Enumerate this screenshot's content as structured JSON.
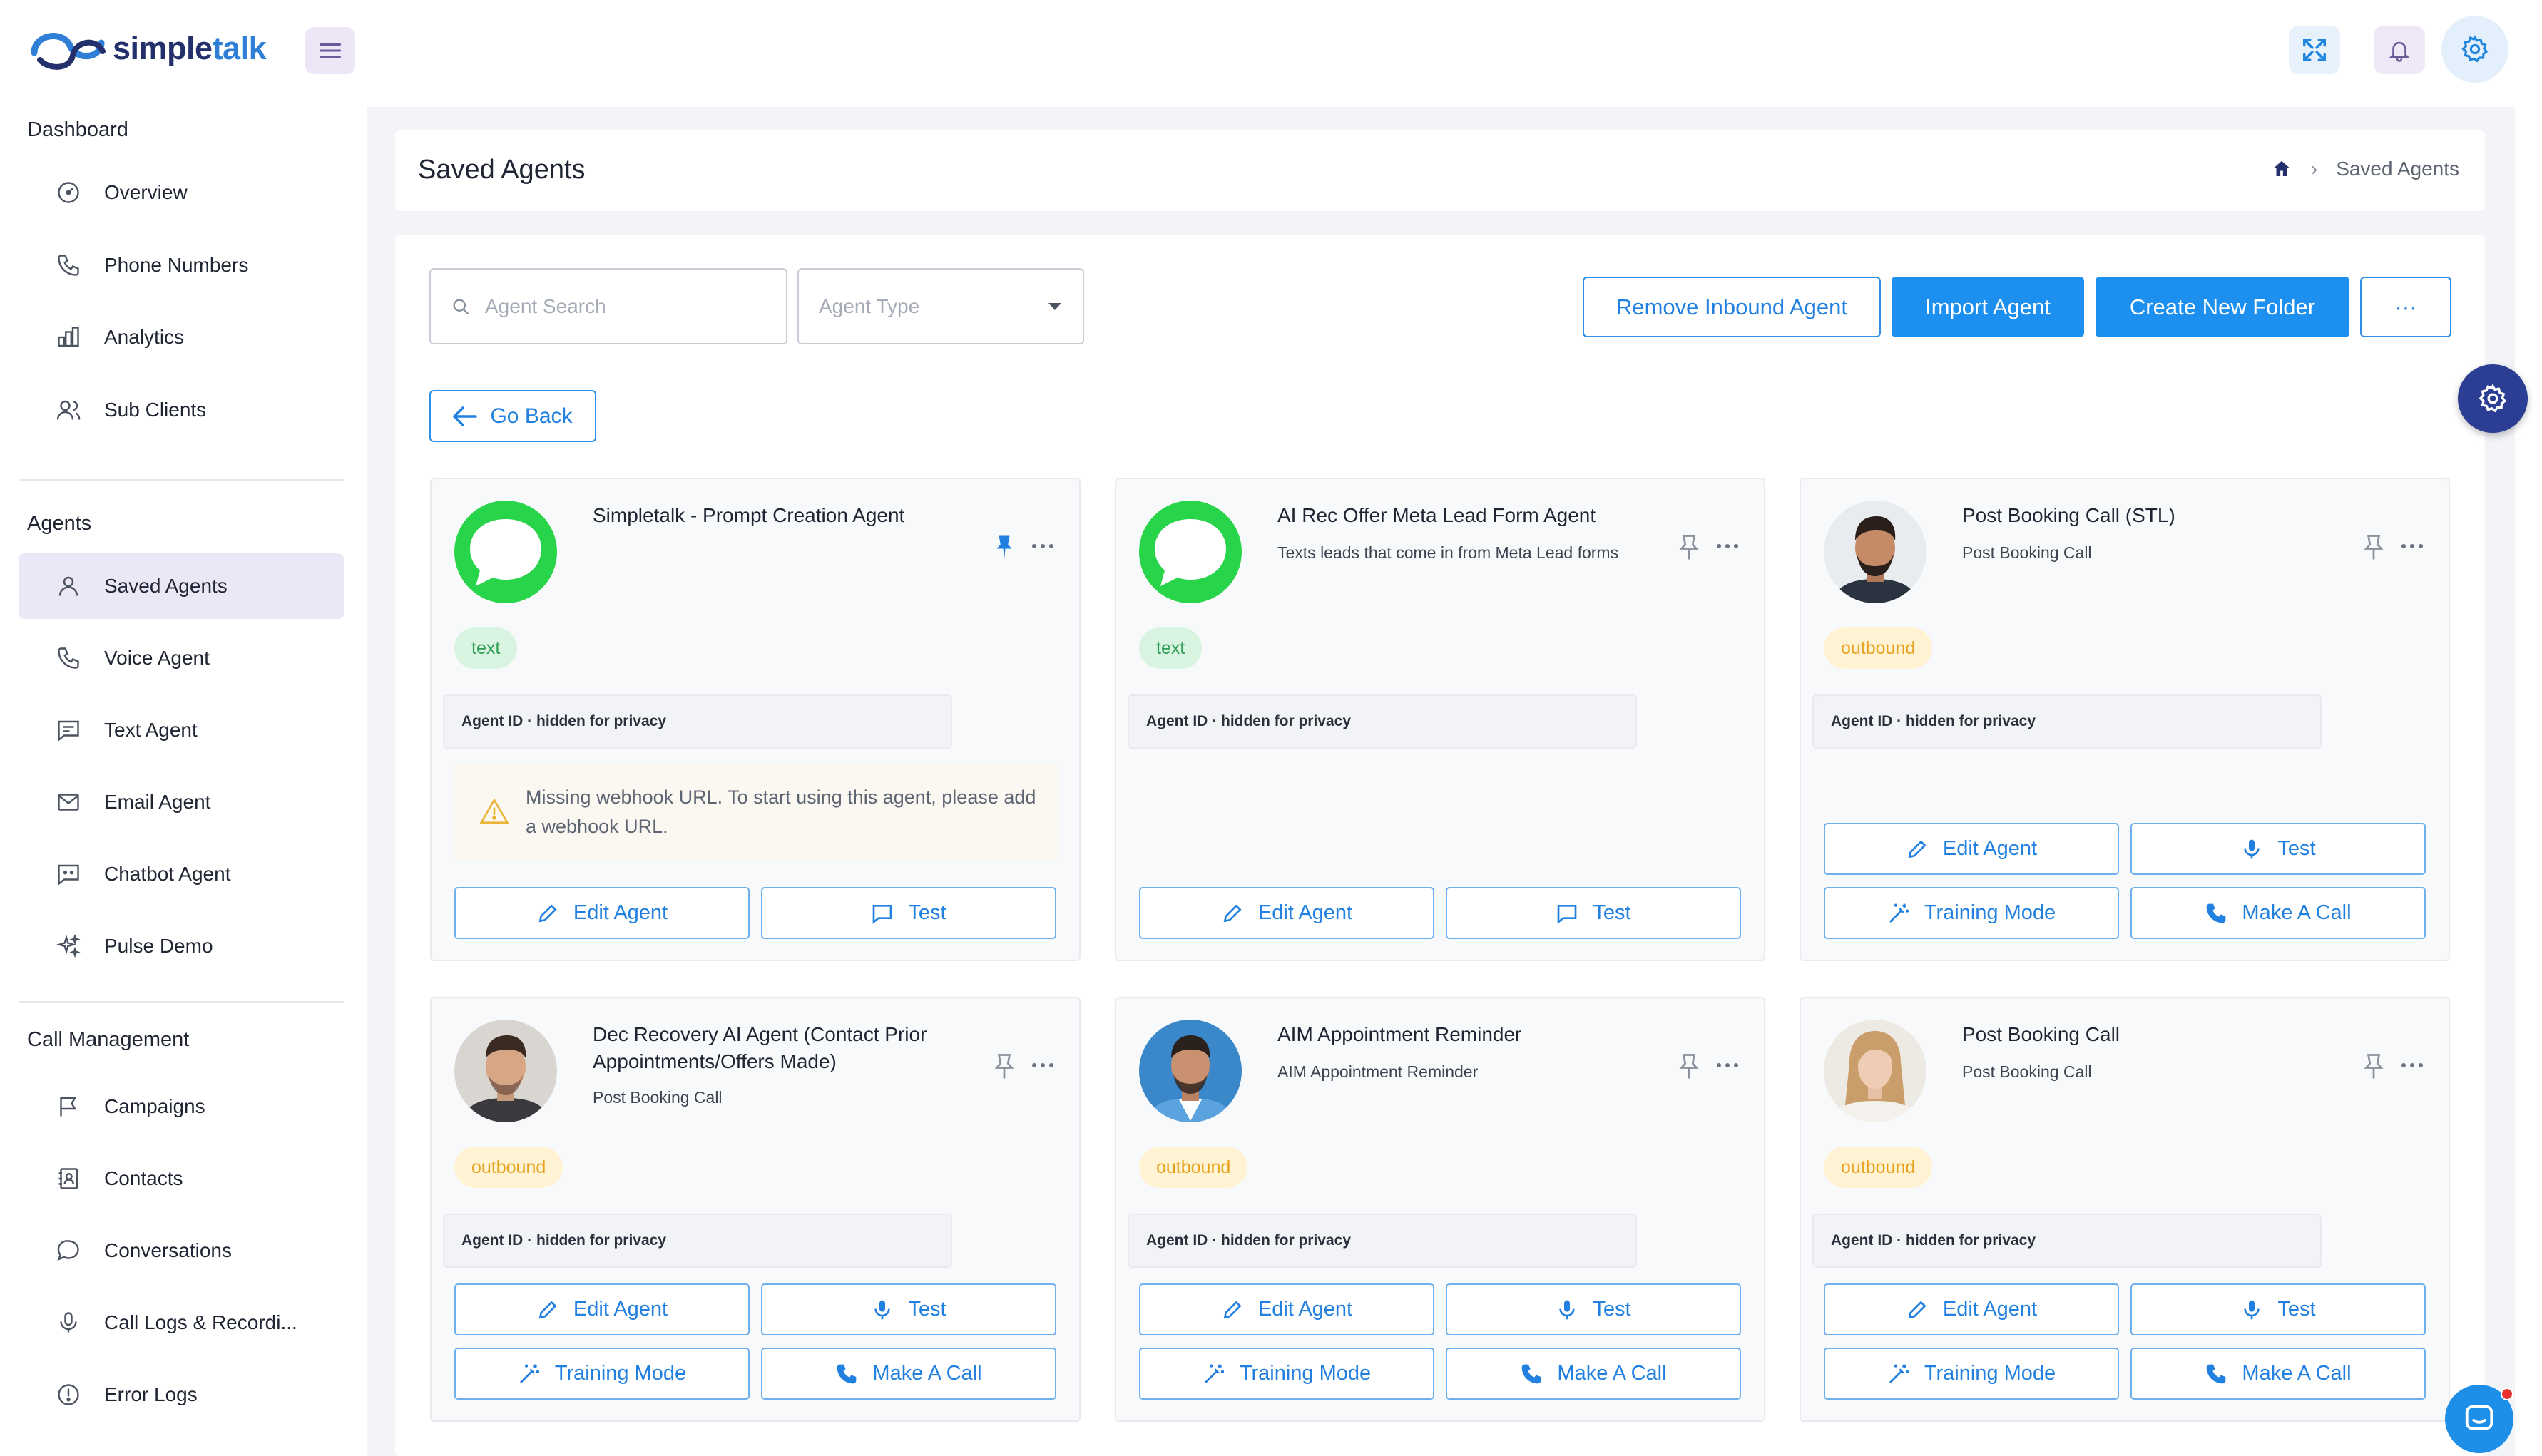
{
  "brand": {
    "logo_part1": "simple",
    "logo_part2": "talk",
    "colors": {
      "navy": "#24306b",
      "blue": "#2f7fd6"
    }
  },
  "header": {
    "icons": [
      "menu-icon",
      "fullscreen-icon",
      "bell-icon",
      "gear-icon"
    ]
  },
  "sidebar": {
    "sections": [
      {
        "title": "Dashboard",
        "items": [
          {
            "label": "Overview",
            "icon": "gauge-icon"
          },
          {
            "label": "Phone Numbers",
            "icon": "phone-icon"
          },
          {
            "label": "Analytics",
            "icon": "bar-chart-icon"
          },
          {
            "label": "Sub Clients",
            "icon": "users-icon"
          }
        ]
      },
      {
        "title": "Agents",
        "items": [
          {
            "label": "Saved Agents",
            "icon": "user-icon",
            "active": true
          },
          {
            "label": "Voice Agent",
            "icon": "phone-icon"
          },
          {
            "label": "Text Agent",
            "icon": "message-icon"
          },
          {
            "label": "Email Agent",
            "icon": "mail-icon"
          },
          {
            "label": "Chatbot Agent",
            "icon": "chatbot-icon"
          },
          {
            "label": "Pulse Demo",
            "icon": "sparkle-icon"
          }
        ]
      },
      {
        "title": "Call Management",
        "items": [
          {
            "label": "Campaigns",
            "icon": "flag-icon"
          },
          {
            "label": "Contacts",
            "icon": "contacts-icon"
          },
          {
            "label": "Conversations",
            "icon": "chat-icon"
          },
          {
            "label": "Call Logs & Recordi...",
            "icon": "microphone-icon"
          },
          {
            "label": "Error Logs",
            "icon": "alert-circle-icon"
          }
        ]
      }
    ]
  },
  "page": {
    "title": "Saved Agents",
    "breadcrumb": {
      "current": "Saved Agents"
    }
  },
  "toolbar": {
    "search_placeholder": "Agent Search",
    "type_placeholder": "Agent Type",
    "remove_inbound": "Remove Inbound Agent",
    "import_agent": "Import Agent",
    "create_folder": "Create New Folder",
    "more": "···",
    "go_back": "Go Back"
  },
  "buttons": {
    "edit": "Edit Agent",
    "test": "Test",
    "training": "Training Mode",
    "call": "Make A Call"
  },
  "agents": [
    {
      "name": "Simpletalk - Prompt Creation Agent",
      "desc": "",
      "tag": "text",
      "agent_id": "Agent ID · hidden for privacy",
      "pinned": true,
      "warning": "Missing webhook URL. To start using this agent, please add a webhook URL."
    },
    {
      "name": "AI Rec Offer Meta Lead Form Agent",
      "desc": "Texts leads that come in from Meta Lead forms",
      "tag": "text",
      "agent_id": "Agent ID · hidden for privacy",
      "pinned": false
    },
    {
      "name": "Post Booking Call (STL)",
      "desc": "Post Booking Call",
      "tag": "outbound",
      "agent_id": "Agent ID · hidden for privacy",
      "pinned": false
    },
    {
      "name": "Dec Recovery AI Agent (Contact Prior Appointments/Offers Made)",
      "desc": "Post Booking Call",
      "tag": "outbound",
      "agent_id": "Agent ID · hidden for privacy",
      "pinned": false
    },
    {
      "name": "AIM Appointment Reminder",
      "desc": "AIM Appointment Reminder",
      "tag": "outbound",
      "agent_id": "Agent ID · hidden for privacy",
      "pinned": false
    },
    {
      "name": "Post Booking Call",
      "desc": "Post Booking Call",
      "tag": "outbound",
      "agent_id": "Agent ID · hidden for privacy",
      "pinned": false
    }
  ]
}
